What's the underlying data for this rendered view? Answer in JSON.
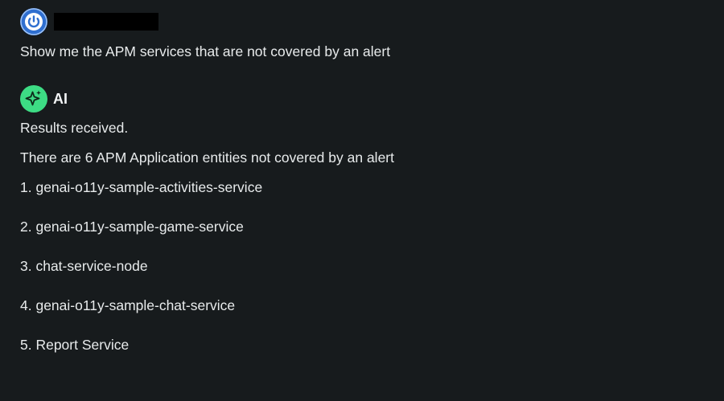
{
  "user_message": {
    "avatar_icon": "power-icon",
    "text": "Show me the APM services that are not covered by an alert"
  },
  "ai_message": {
    "avatar_icon": "sparkle-icon",
    "sender": "AI",
    "status": "Results received.",
    "summary": "There are 6 APM Application entities not covered by an alert",
    "results": [
      {
        "label": "1. genai-o11y-sample-activities-service"
      },
      {
        "label": "2. genai-o11y-sample-game-service"
      },
      {
        "label": "3. chat-service-node"
      },
      {
        "label": "4. genai-o11y-sample-chat-service"
      },
      {
        "label": "5. Report Service"
      }
    ]
  },
  "colors": {
    "background": "#171b1d",
    "text": "#e8ebec",
    "user_avatar": "#2f6fd0",
    "ai_avatar": "#3ddc84"
  }
}
